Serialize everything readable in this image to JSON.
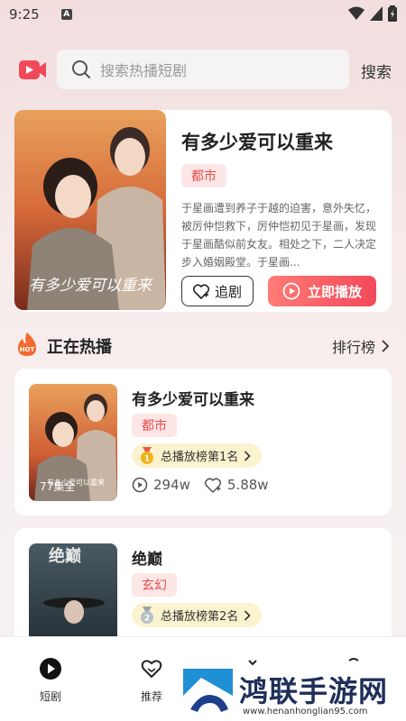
{
  "status_bar": {
    "time": "9:25",
    "a_icon": "A"
  },
  "search": {
    "placeholder": "搜索热播短剧",
    "button_label": "搜索"
  },
  "featured": {
    "title": "有多少爱可以重来",
    "tag": "都市",
    "description": "于星画遭到养子于越的迫害，意外失忆，被厉仲恺救下，厉仲恺初见于星画，发现于星画酷似前女友。相处之下，二人决定步入婚姻殿堂。于星画...",
    "poster_text": "有多少爱可以重来",
    "follow_label": "追剧",
    "play_label": "立即播放"
  },
  "section": {
    "hot_badge": "HOT",
    "title": "正在热播",
    "ranking_label": "排行榜"
  },
  "dramas": [
    {
      "title": "有多少爱可以重来",
      "tag": "都市",
      "rank_text": "总播放榜第1名",
      "rank_number": "1",
      "poster_text": "有多少爱可以重来",
      "episodes": "77集全",
      "plays": "294w",
      "likes": "5.88w"
    },
    {
      "title": "绝巅",
      "tag": "玄幻",
      "rank_text": "总播放榜第2名",
      "rank_number": "2",
      "poster_text": "绝巅"
    }
  ],
  "bottom_nav": [
    {
      "label": "短剧",
      "icon": "play-circle-icon"
    },
    {
      "label": "推荐",
      "icon": "heart-icon"
    },
    {
      "label": "",
      "icon": "tab3-icon"
    },
    {
      "label": "",
      "icon": "tab4-icon"
    }
  ],
  "watermark": {
    "title": "鸿联手游网",
    "url": "www.henanhonglian95.com"
  },
  "colors": {
    "accent": "#f2495a",
    "tag_bg": "#fde6e6",
    "tag_text": "#e54b4b",
    "rank_bg": "#fbf3cf"
  }
}
